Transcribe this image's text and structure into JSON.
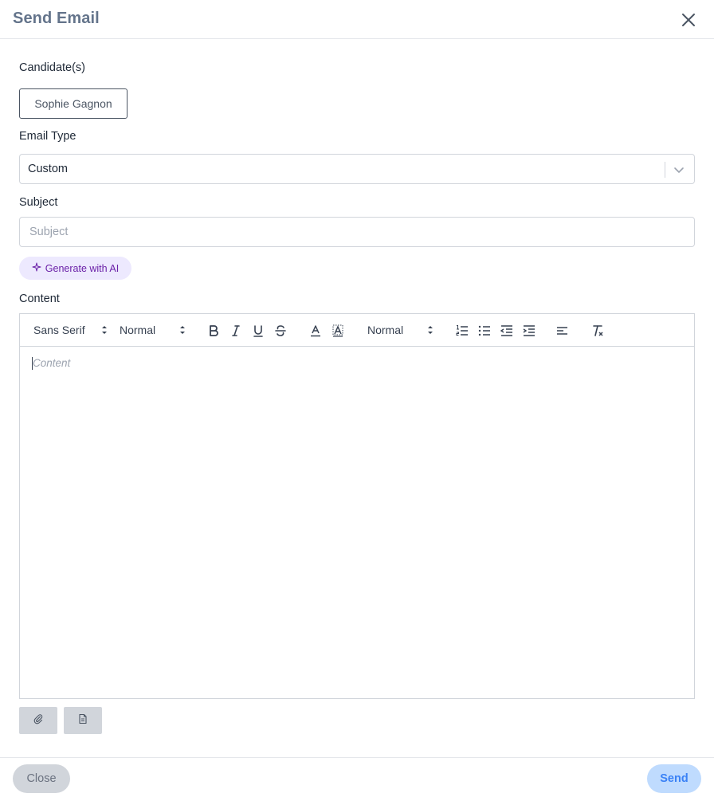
{
  "dialog": {
    "title": "Send Email",
    "close_icon": "close-icon"
  },
  "candidates": {
    "label": "Candidate(s)",
    "chips": [
      "Sophie Gagnon"
    ]
  },
  "email_type": {
    "label": "Email Type",
    "value": "Custom",
    "icon": "chevron-down-icon"
  },
  "subject": {
    "label": "Subject",
    "placeholder": "Subject",
    "value": ""
  },
  "ai": {
    "label": "Generate with AI",
    "icon": "sparkle-icon",
    "color": "#6b21a8",
    "background": "#ede9fe"
  },
  "content": {
    "label": "Content",
    "placeholder": "Content",
    "toolbar": {
      "font_family": "Sans Serif",
      "font_size": "Normal",
      "heading": "Normal",
      "buttons": [
        "bold-icon",
        "italic-icon",
        "underline-icon",
        "strikethrough-icon",
        "text-color-icon",
        "background-color-icon",
        "ordered-list-icon",
        "bullet-list-icon",
        "outdent-icon",
        "indent-icon",
        "align-left-icon",
        "clear-format-icon"
      ]
    }
  },
  "attachments": {
    "icons": [
      "paperclip-icon",
      "document-icon"
    ]
  },
  "footer": {
    "close_label": "Close",
    "send_label": "Send",
    "send_color": "#3b82f6"
  }
}
